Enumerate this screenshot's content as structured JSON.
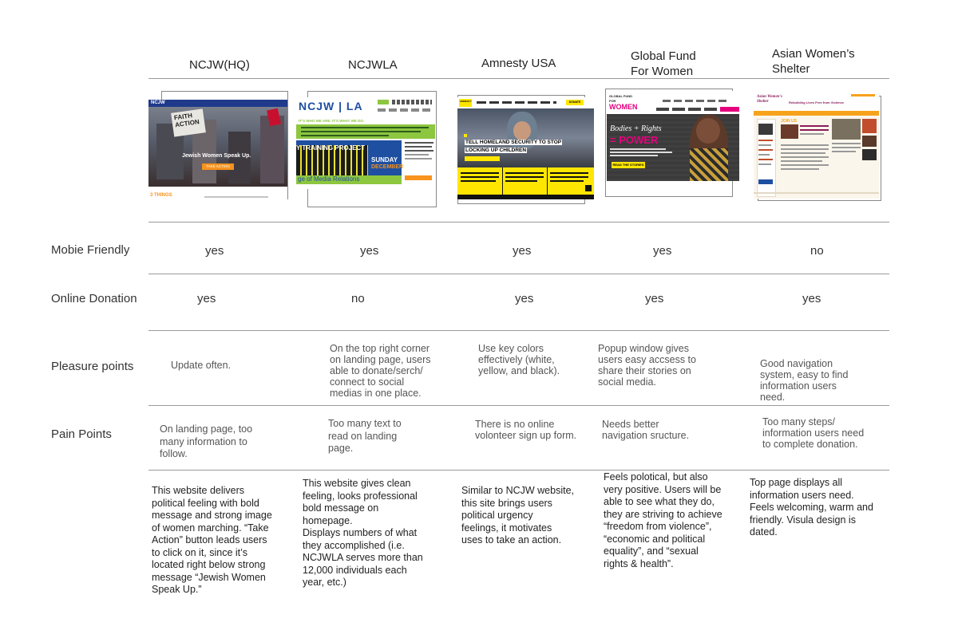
{
  "columns": [
    {
      "name": "NCJW(HQ)"
    },
    {
      "name": "NCJWLA"
    },
    {
      "name": "Amnesty USA"
    },
    {
      "name": "Global Fund For Women",
      "line1": "Global Fund",
      "line2": "For Women"
    },
    {
      "name": "Asian Women’s Shelter",
      "line1": "Asian Women’s",
      "line2": "Shelter"
    }
  ],
  "rows": {
    "mobile": {
      "label": "Mobie Friendly",
      "values": [
        "yes",
        "yes",
        "yes",
        "yes",
        "no"
      ]
    },
    "donation": {
      "label": "Online Donation",
      "values": [
        "yes",
        "no",
        "yes",
        "yes",
        "yes"
      ]
    },
    "pleasure": {
      "label": "Pleasure points",
      "values": [
        [
          "Update often."
        ],
        [
          "On the top right corner",
          "on landing page, users",
          "able to donate/serch/",
          "connect to social",
          "medias in one place."
        ],
        [
          "Use key colors",
          "effectively (white,",
          "yellow, and black)."
        ],
        [
          "Popup window gives",
          "users easy accsess to",
          "share their stories on",
          "social media."
        ],
        [
          "Good navigation",
          "system, easy to find",
          "information users",
          "need."
        ]
      ]
    },
    "pain": {
      "label": "Pain Points",
      "values": [
        [
          "On landing page, too",
          "many information to",
          "follow."
        ],
        [
          "Too many text to",
          "read on landing",
          "page."
        ],
        [
          "There is no online",
          "volonteer sign up form."
        ],
        [
          "Needs better",
          "navigation sructure."
        ],
        [
          "Too many steps/",
          "information users need",
          "to complete donation."
        ]
      ]
    }
  },
  "descriptions": [
    [
      "This website delivers",
      "political feeling with bold",
      "message and strong image",
      "of women marching. “Take",
      "Action” button leads users",
      "to click on it, since it’s",
      "located right below strong",
      "message “Jewish Women",
      "Speak Up.”"
    ],
    [
      "This website gives clean",
      "feeling, looks professional",
      "bold message on",
      "homepage.",
      "Displays numbers of what",
      "they accomplished (i.e.",
      "NCJWLA serves more than",
      "12,000 individuals each",
      "year, etc.)"
    ],
    [
      "Similar to NCJW website,",
      "this site brings users",
      "political urgency",
      "feelings, it motivates",
      "uses to take an action."
    ],
    [
      "Feels polotical, but also",
      "very positive. Users will be",
      "able to see what they do,",
      "they are striving to achieve",
      "“freedom from violence”,",
      "“economic and political",
      "equality”, and “sexual",
      "rights & health”."
    ],
    [
      "Top page displays all",
      "information users need.",
      "Feels welcoming, warm and",
      "friendly. Visula design is",
      "dated."
    ]
  ],
  "thumbnails": {
    "ncjw": {
      "logo": "NCJW",
      "headline1": "FAITH",
      "headline2": "ACTION",
      "tagline": "Jewish Women Speak Up.",
      "button": "TAKE ACTION",
      "footer": "3 THINGS"
    },
    "ncjwla": {
      "logo": "NCJW | LA",
      "tagline": "IT'S WHO WE ARE. IT'S WHAT WE DO.",
      "banner1": "Y TRAINING PROJECT",
      "banner2": "ge of Media Relations",
      "side1": "SUNDAY",
      "side2": "DECEMBER"
    },
    "amnesty": {
      "logo": "AMNESTY",
      "headline1": "TELL HOMELAND SECURITY TO STOP",
      "headline2": "LOCKING UP CHILDREN",
      "button": "DONATE"
    },
    "gfw": {
      "logo1": "GLOBAL FUND",
      "logo2": "FOR",
      "logo3": "WOMEN",
      "text1": "Bodies + Rights",
      "text2": "= POWER",
      "button": "READ THE STORIES"
    },
    "aws": {
      "logo": "Asian Women's Shelter",
      "banner": "Rebuilding Lives Free from Violence",
      "join": "JOIN US"
    }
  },
  "colors": {
    "rule": "#9a9a9a",
    "ncjw_blue": "#1f3a8a",
    "ncjw_orange": "#f7931e",
    "ncjwla_blue": "#1e4fa0",
    "ncjwla_green": "#8dc63f",
    "amnesty_yellow": "#ffe600",
    "gfw_magenta": "#e6007e",
    "aws_orange": "#f7a21b"
  }
}
